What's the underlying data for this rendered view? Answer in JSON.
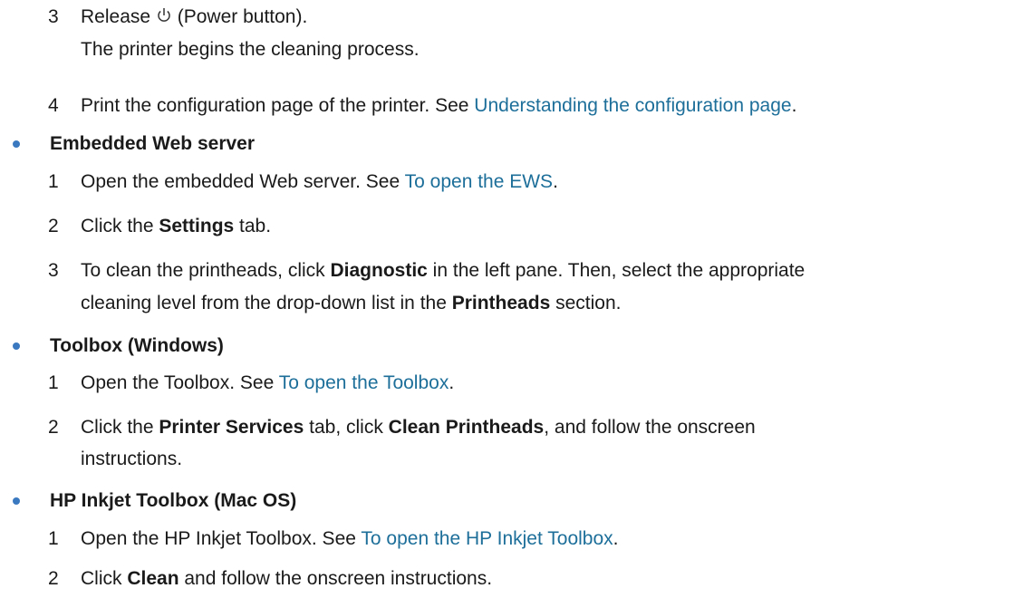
{
  "colors": {
    "text": "#1a1a1a",
    "link": "#1d6f9a",
    "bullet": "#3a78bf"
  },
  "icons": {
    "power": "power-button-icon"
  },
  "top_steps": [
    {
      "num": "3",
      "before_icon": "Release",
      "after_icon": "(Power button).",
      "continuation": "The printer begins the cleaning process."
    },
    {
      "num": "4",
      "text": "Print the configuration page of the printer. See ",
      "link": "Understanding the configuration page",
      "tail": "."
    }
  ],
  "sections": [
    {
      "heading": "Embedded Web server",
      "steps": [
        {
          "num": "1",
          "text": "Open the embedded Web server. See ",
          "link": "To open the EWS",
          "tail": "."
        },
        {
          "num": "2",
          "pre": "Click the ",
          "bold": "Settings",
          "post": " tab."
        },
        {
          "num": "3",
          "pre": "To clean the printheads, click ",
          "bold": "Diagnostic",
          "post": " in the left pane. Then, select the appropriate",
          "line2_pre": "cleaning level from the drop-down list in the ",
          "line2_bold": "Printheads",
          "line2_post": " section."
        }
      ]
    },
    {
      "heading": "Toolbox (Windows)",
      "steps": [
        {
          "num": "1",
          "text": "Open the Toolbox. See ",
          "link": "To open the Toolbox",
          "tail": "."
        },
        {
          "num": "2",
          "pre": "Click the ",
          "bold": "Printer Services",
          "mid": " tab, click ",
          "bold2": "Clean Printheads",
          "post": ", and follow the onscreen",
          "line2": "instructions."
        }
      ]
    },
    {
      "heading": "HP Inkjet Toolbox (Mac OS)",
      "steps": [
        {
          "num": "1",
          "text": "Open the HP Inkjet Toolbox. See ",
          "link": "To open the HP Inkjet Toolbox",
          "tail": "."
        },
        {
          "num": "2",
          "pre": "Click ",
          "bold": "Clean",
          "post": " and follow the onscreen instructions."
        }
      ]
    }
  ]
}
